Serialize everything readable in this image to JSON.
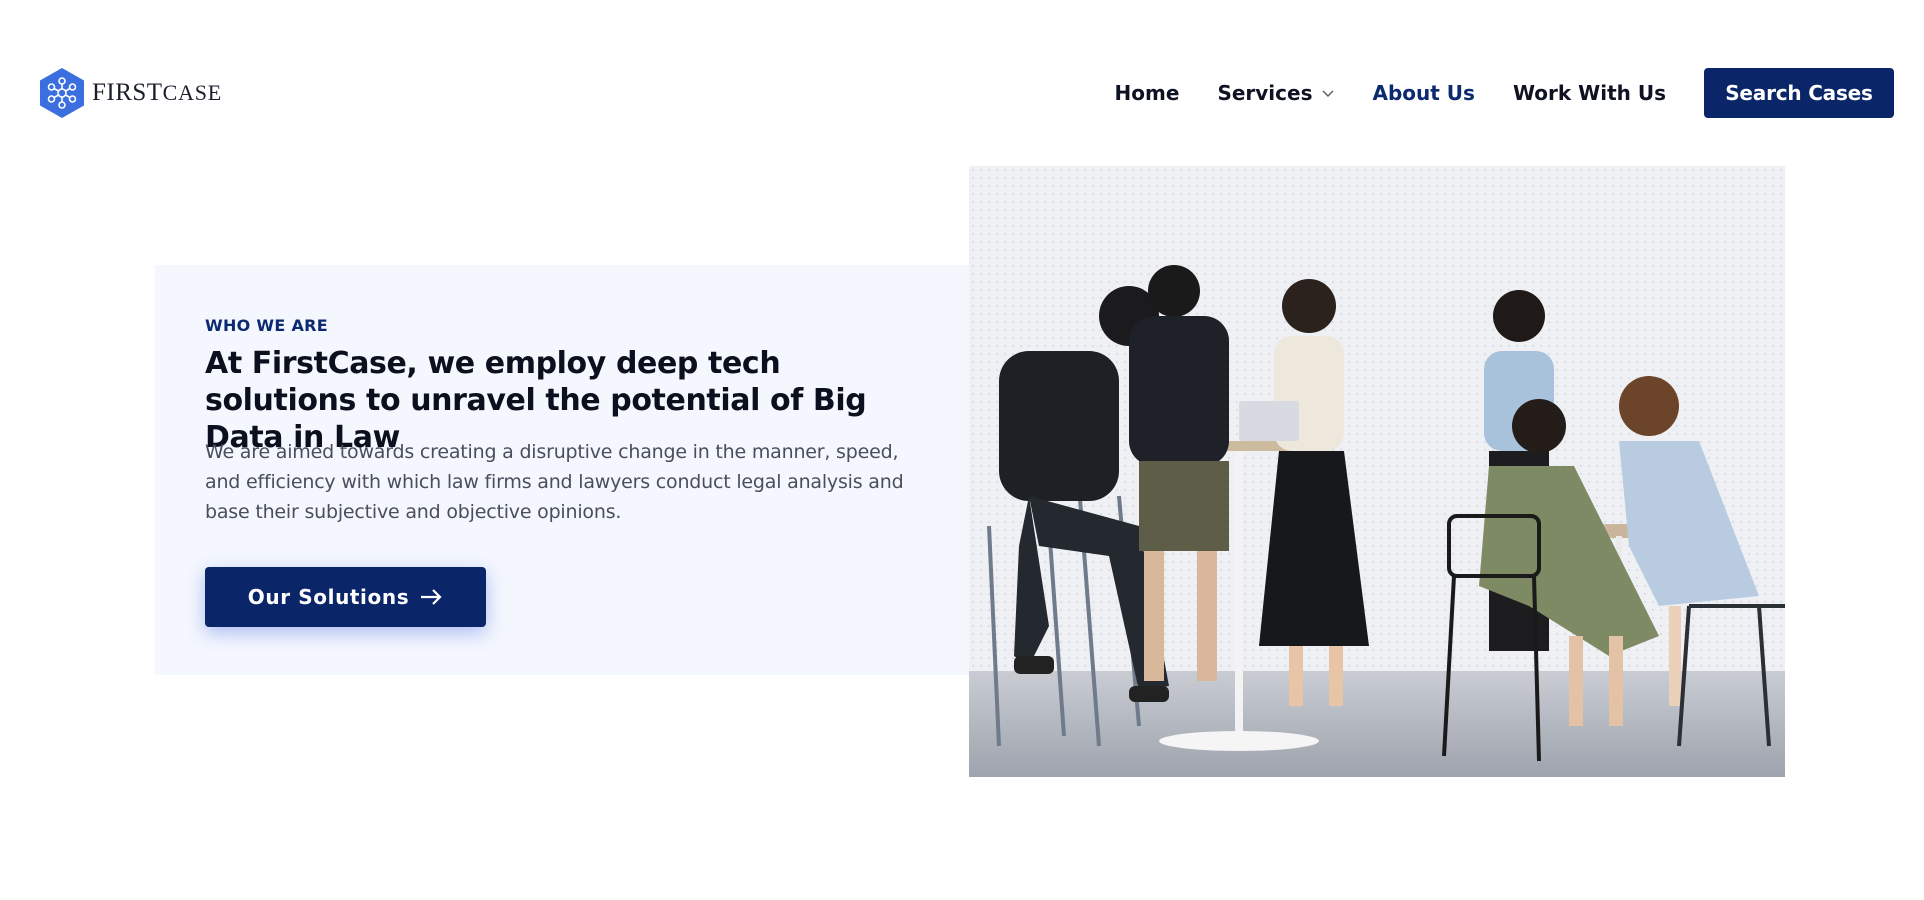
{
  "header": {
    "logo": {
      "text_main": "FIRST",
      "text_case": "CASE"
    },
    "nav": [
      {
        "label": "Home"
      },
      {
        "label": "Services"
      },
      {
        "label": "About Us"
      },
      {
        "label": "Work With Us"
      }
    ],
    "cta_label": "Search Cases"
  },
  "hero": {
    "eyebrow": "WHO WE ARE",
    "title": "At FirstCase, we employ deep tech solutions to unravel the potential of Big Data in Law",
    "description": "We are aimed towards creating a disruptive change in the manner, speed, and efficiency with which law firms and lawyers conduct legal analysis and base their subjective and objective opinions.",
    "cta_label": "Our Solutions"
  },
  "colors": {
    "brand_navy": "#0a2568",
    "logo_blue": "#3b6fe0",
    "card_bg": "#f4f7fe"
  },
  "icons": {
    "logo": "hexagon-network-icon",
    "services": "chevron-down-icon",
    "cta": "arrow-right-icon"
  }
}
